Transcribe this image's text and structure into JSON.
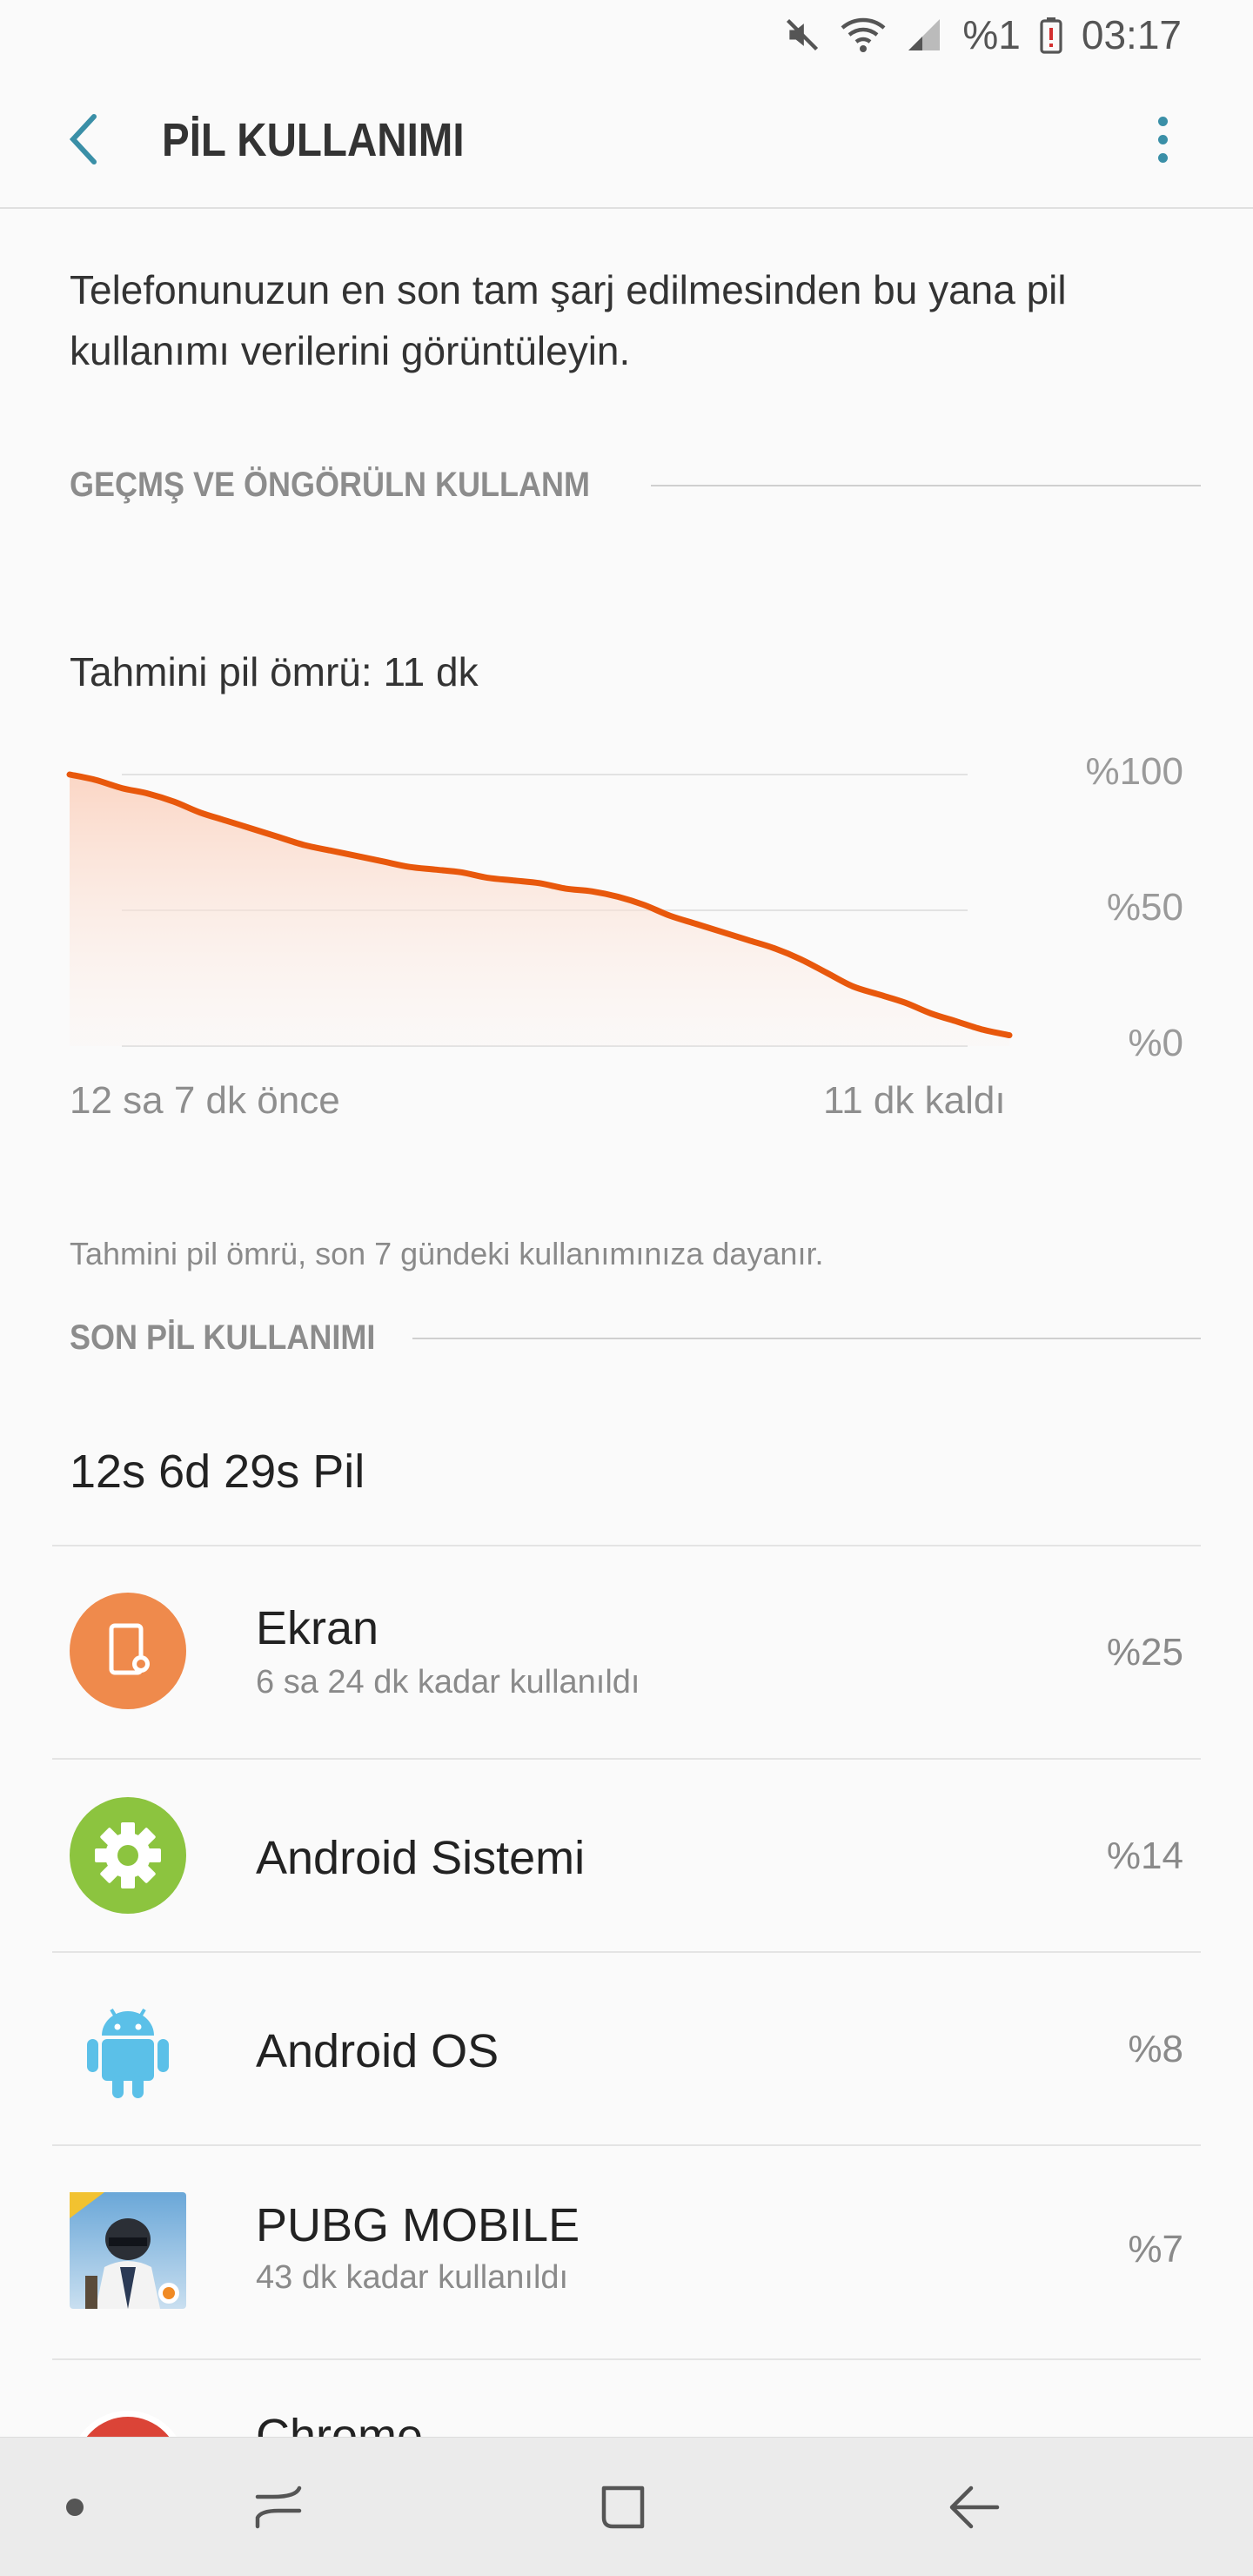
{
  "status_bar": {
    "battery_percent": "%1",
    "time": "03:17",
    "icons": [
      "mute-icon",
      "wifi-icon",
      "signal-icon",
      "battery-low-icon"
    ]
  },
  "app_bar": {
    "title": "PİL KULLANIMI",
    "back_icon": "chevron-left-icon",
    "more_icon": "more-vertical-icon"
  },
  "intro_text": "Telefonunuzun en son tam şarj edilmesinden bu yana pil kullanımı verilerini görüntüleyin.",
  "history_section": {
    "header": "GEÇMŞ VE ÖNGÖRÜLN KULLANM",
    "estimate_label": "Tahmini pil ömrü: 11 dk",
    "footnote": "Tahmini pil ömrü, son 7 gündeki kullanımınıza dayanır."
  },
  "chart_data": {
    "type": "area",
    "x_start_label": "12 sa 7 dk önce",
    "x_end_label": "11 dk kaldı",
    "y_ticks": [
      "%100",
      "%50",
      "%0"
    ],
    "ylim": [
      0,
      100
    ],
    "grid": true,
    "color": "#e8580c",
    "fill_color": "#fbd7c6",
    "series": [
      {
        "values": [
          100,
          98,
          95,
          93,
          90,
          86,
          83,
          80,
          77,
          74,
          72,
          70,
          68,
          66,
          65,
          64,
          62,
          61,
          60,
          58,
          57,
          55,
          52,
          48,
          45,
          42,
          39,
          36,
          32,
          27,
          22,
          19,
          16,
          12,
          9,
          6,
          4
        ]
      }
    ]
  },
  "recent_section": {
    "header": "SON PİL KULLANIMI",
    "summary": "12s 6d 29s Pil"
  },
  "usage_items": [
    {
      "name": "Ekran",
      "sub": "6 sa 24 dk kadar kullanıldı",
      "percent": "%25",
      "icon": "screen-brightness-icon",
      "color": "#ef8a4c"
    },
    {
      "name": "Android Sistemi",
      "sub": "",
      "percent": "%14",
      "icon": "gear-icon",
      "color": "#8cc43f"
    },
    {
      "name": "Android OS",
      "sub": "",
      "percent": "%8",
      "icon": "android-robot-icon",
      "color": "#5bc0e8"
    },
    {
      "name": "PUBG MOBILE",
      "sub": "43 dk kadar kullanıldı",
      "percent": "%7",
      "icon": "pubg-app-icon",
      "color": "#3b6fb0"
    },
    {
      "name": "Chrome",
      "sub": "",
      "percent": "",
      "icon": "chrome-icon",
      "color": "#db4437"
    }
  ],
  "nav_bar": {
    "items": [
      "dot-icon",
      "recent-apps-icon",
      "home-icon",
      "back-arrow-icon"
    ]
  }
}
